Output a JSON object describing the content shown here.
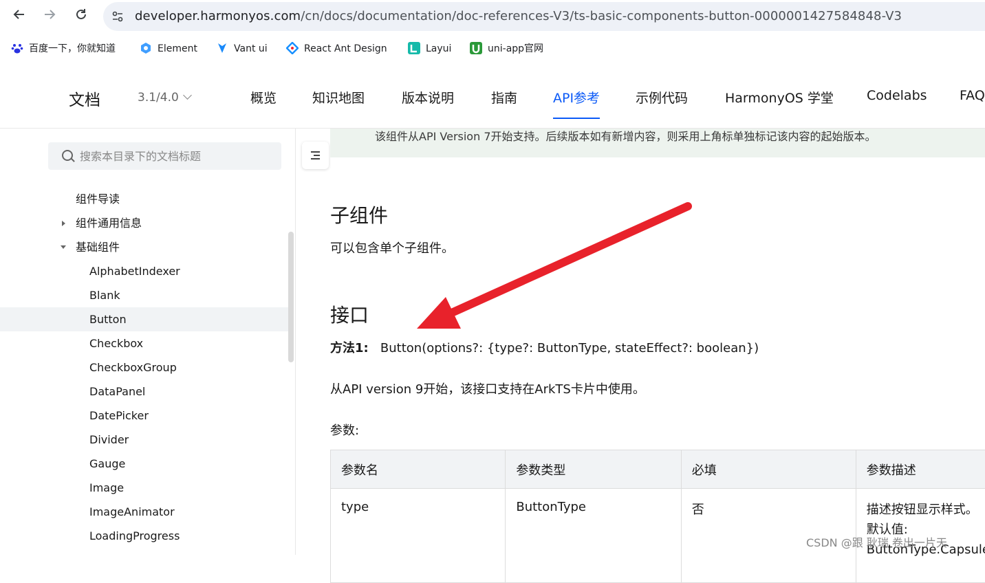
{
  "browser": {
    "url_host": "developer.harmonyos.com",
    "url_path": "/cn/docs/documentation/doc-references-V3/ts-basic-components-button-0000001427584848-V3",
    "bookmarks": [
      {
        "label": "百度一下，你就知道",
        "icon": "baidu-paw-icon",
        "color": "#2932e1"
      },
      {
        "label": "Element",
        "icon": "element-logo-icon",
        "color": "#409eff"
      },
      {
        "label": "Vant ui",
        "icon": "vant-logo-icon",
        "color": "#1989fa"
      },
      {
        "label": "React Ant Design",
        "icon": "ant-design-logo-icon",
        "color": "#1890ff"
      },
      {
        "label": "Layui",
        "icon": "layui-logo-icon",
        "color": "#16baaa"
      },
      {
        "label": "uni-app官网",
        "icon": "uniapp-logo-icon",
        "color": "#2b9939"
      }
    ]
  },
  "header": {
    "title": "文档",
    "version": "3.1/4.0",
    "nav": [
      {
        "label": "概览",
        "active": false
      },
      {
        "label": "知识地图",
        "active": false
      },
      {
        "label": "版本说明",
        "active": false
      },
      {
        "label": "指南",
        "active": false
      },
      {
        "label": "API参考",
        "active": true
      },
      {
        "label": "示例代码",
        "active": false
      },
      {
        "label": "HarmonyOS 学堂",
        "active": false
      },
      {
        "label": "Codelabs",
        "active": false
      },
      {
        "label": "FAQ",
        "active": false
      }
    ],
    "accent": "#0a59f7"
  },
  "sidebar": {
    "search_placeholder": "搜索本目录下的文档标题",
    "items": [
      {
        "label": "组件导读",
        "level": 1,
        "expander": "none"
      },
      {
        "label": "组件通用信息",
        "level": 1,
        "expander": "collapsed"
      },
      {
        "label": "基础组件",
        "level": 1,
        "expander": "expanded"
      },
      {
        "label": "AlphabetIndexer",
        "level": 2
      },
      {
        "label": "Blank",
        "level": 2
      },
      {
        "label": "Button",
        "level": 2,
        "selected": true
      },
      {
        "label": "Checkbox",
        "level": 2
      },
      {
        "label": "CheckboxGroup",
        "level": 2
      },
      {
        "label": "DataPanel",
        "level": 2
      },
      {
        "label": "DatePicker",
        "level": 2
      },
      {
        "label": "Divider",
        "level": 2
      },
      {
        "label": "Gauge",
        "level": 2
      },
      {
        "label": "Image",
        "level": 2
      },
      {
        "label": "ImageAnimator",
        "level": 2
      },
      {
        "label": "LoadingProgress",
        "level": 2
      }
    ]
  },
  "main": {
    "notice": "该组件从API Version 7开始支持。后续版本如有新增内容，则采用上角标单独标记该内容的起始版本。",
    "child_heading": "子组件",
    "child_text": "可以包含单个子组件。",
    "api_heading": "接口",
    "method_label": "方法1:",
    "method_sig": "Button(options?: {type?: ButtonType, stateEffect?: boolean})",
    "card_support": "从API version 9开始，该接口支持在ArkTS卡片中使用。",
    "params_label": "参数:",
    "table": {
      "headers": [
        "参数名",
        "参数类型",
        "必填",
        "参数描述"
      ],
      "rows": [
        {
          "name": "type",
          "type": "ButtonType",
          "required": "否",
          "desc": [
            "描述按钮显示样式。",
            "默认值:",
            "ButtonType.Capsule"
          ]
        }
      ]
    }
  },
  "annotation": {
    "arrow_color": "#e8222b"
  },
  "watermark": "CSDN @跟 耿瑞 卷出一片天"
}
